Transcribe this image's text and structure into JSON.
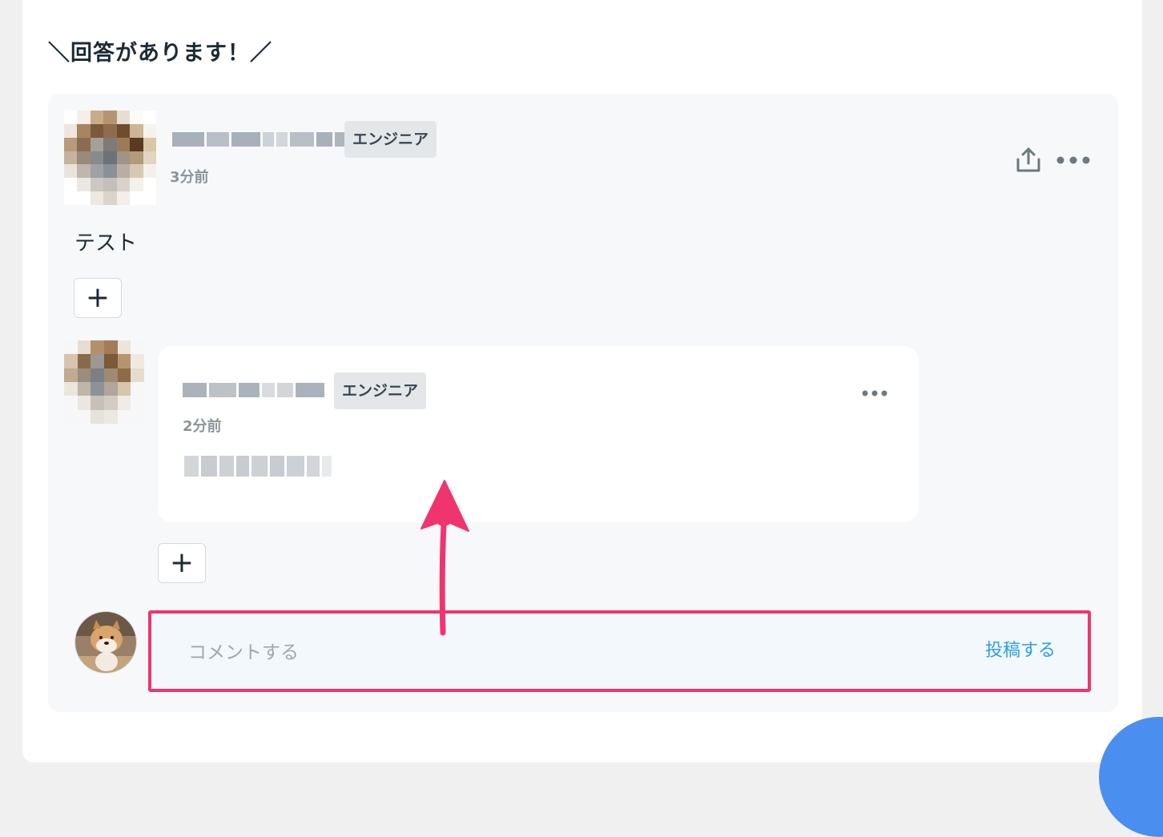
{
  "heading": "＼回答があります！／",
  "answer": {
    "role_badge": "エンジニア",
    "time": "3分前",
    "body": "テスト",
    "icons": {
      "share": "share-upload-icon",
      "more": "more-horizontal-icon",
      "add_reaction": "plus-icon"
    }
  },
  "reply": {
    "role_badge": "エンジニア",
    "time": "2分前",
    "icons": {
      "more": "more-horizontal-icon",
      "add_reaction": "plus-icon"
    }
  },
  "comment_form": {
    "placeholder": "コメントする",
    "value": "",
    "submit_label": "投稿する",
    "highlight_color": "#f0356e",
    "submit_color": "#2f9fe0"
  }
}
